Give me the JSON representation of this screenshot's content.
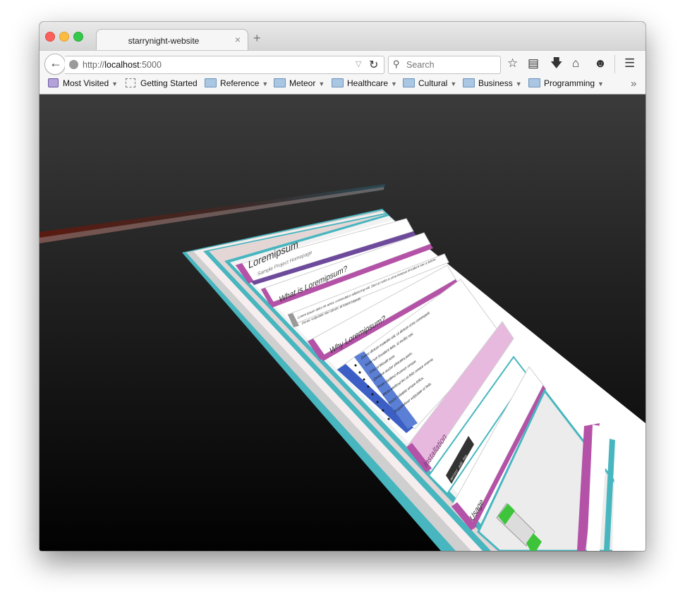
{
  "window": {
    "tab_title": "starrynight-website",
    "new_tab_symbol": "+",
    "tab_close_symbol": "×"
  },
  "navbar": {
    "url_prefix": "http://",
    "url_host": "localhost",
    "url_port": ":5000",
    "search_placeholder": "Search",
    "icons": [
      "back-arrow-icon",
      "globe-icon",
      "dropdown-icon",
      "reload-icon",
      "search-icon",
      "star-icon",
      "reading-list-icon",
      "download-icon",
      "home-icon",
      "hello-icon",
      "menu-icon"
    ]
  },
  "bookmarks": [
    {
      "label": "Most Visited",
      "icon": "most-visited-icon",
      "dropdown": true
    },
    {
      "label": "Getting Started",
      "icon": "page-icon",
      "dropdown": false
    },
    {
      "label": "Reference",
      "icon": "folder-icon",
      "dropdown": true
    },
    {
      "label": "Meteor",
      "icon": "folder-icon",
      "dropdown": true
    },
    {
      "label": "Healthcare",
      "icon": "folder-icon",
      "dropdown": true
    },
    {
      "label": "Cultural",
      "icon": "folder-icon",
      "dropdown": true
    },
    {
      "label": "Business",
      "icon": "folder-icon",
      "dropdown": true
    },
    {
      "label": "Programming",
      "icon": "folder-icon",
      "dropdown": true
    }
  ],
  "scene": {
    "title": "Loremipsum",
    "subtitle": "Sample Project Homepage",
    "heading_what": "What is Loremipsum?",
    "body_what_1": "Lorem ipsum dolor sit amet, consectetur adipiscing elit. Sed ut rusto a urna tempus tincidunt nec a lorem.",
    "body_what_2": "Donec vulputate nisi rutrum, et lorem blandit.",
    "heading_why": "Why Loremipsum?",
    "bullets": [
      "Donec dictum molestie elit, ut dictum urna consequat.",
      "Nulla non tincidunt felis, id mollis nisl.",
      "Cras id blandit sem.",
      "Quisque auctor pharetra justo.",
      "Proin eleifend rhoncus ornare.",
      "Morbi eleifend leo et felis ornare viverra.",
      "Fusce volutpat ornare tellus.",
      "Suspendisse vulputate ut felis."
    ],
    "heading_installation": "Installation",
    "install_command": "meteor add foo",
    "heading_usage": "Usage",
    "colors": {
      "teal": "#47b6bf",
      "magenta": "#b452a7",
      "purple": "#6d4a9c",
      "blue": "#3b5fc4",
      "pink_panel": "#e7b9df",
      "panel_white": "#ffffff",
      "panel_grey": "#ececec",
      "green_accent": "#3ec43b"
    }
  }
}
